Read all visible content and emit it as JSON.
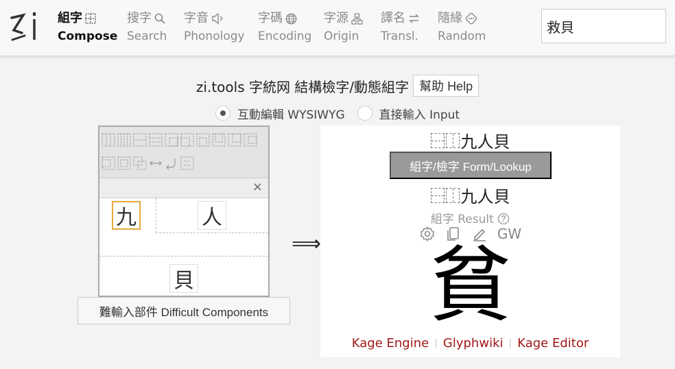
{
  "nav": {
    "items": [
      {
        "zh": "組字",
        "en": "Compose",
        "icon": "compose-grid-icon",
        "active": true
      },
      {
        "zh": "搜字",
        "en": "Search",
        "icon": "search-icon"
      },
      {
        "zh": "字音",
        "en": "Phonology",
        "icon": "speaker-icon"
      },
      {
        "zh": "字碼",
        "en": "Encoding",
        "icon": "globe-icon"
      },
      {
        "zh": "字源",
        "en": "Origin",
        "icon": "hierarchy-icon"
      },
      {
        "zh": "譯名",
        "en": "Transl.",
        "icon": "swap-icon"
      },
      {
        "zh": "隨緣",
        "en": "Random",
        "icon": "dice-icon"
      }
    ],
    "search_value": "救貝"
  },
  "title": "zi.tools 字統网 結構檢字/動態組字",
  "help_label": "幫助 Help",
  "modes": {
    "wysiwyg": "互動編輯 WYSIWYG",
    "input": "直接輸入 Input",
    "selected": "wysiwyg"
  },
  "editor": {
    "components": [
      "九",
      "人",
      "貝"
    ],
    "difficult_label": "難輸入部件 Difficult Components"
  },
  "result": {
    "ids_chars": "九人貝",
    "lookup_label": "組字/檢字 Form/Lookup",
    "result_label": "組字 Result",
    "gw_label": "GW",
    "glyph": "貧",
    "links": [
      "Kage Engine",
      "Glyphwiki",
      "Kage Editor"
    ]
  },
  "colors": {
    "accent_link": "#a01818",
    "selected_component_border": "#e8a93a",
    "lookup_button": "#9a9a9a"
  }
}
